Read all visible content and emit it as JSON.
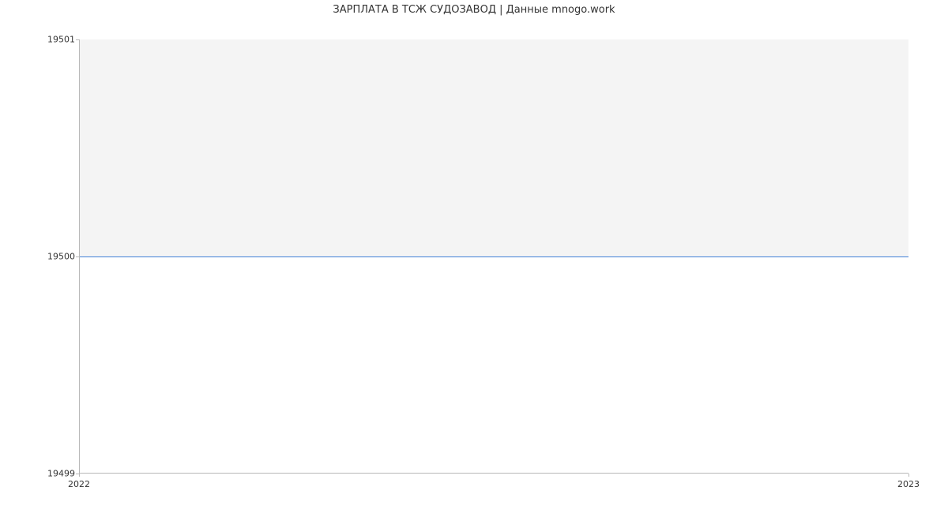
{
  "chart_data": {
    "type": "line",
    "title": "ЗАРПЛАТА В ТСЖ СУДОЗАВОД | Данные mnogo.work",
    "xlabel": "",
    "ylabel": "",
    "x": [
      "2022",
      "2023"
    ],
    "values": [
      19500,
      19500
    ],
    "ylim": [
      19499,
      19501
    ],
    "yticks": [
      "19499",
      "19500",
      "19501"
    ],
    "xticks": [
      "2022",
      "2023"
    ],
    "line_color": "#3f7fd7"
  },
  "yticks": {
    "t0": "19499",
    "t1": "19500",
    "t2": "19501"
  },
  "xticks": {
    "t0": "2022",
    "t1": "2023"
  }
}
